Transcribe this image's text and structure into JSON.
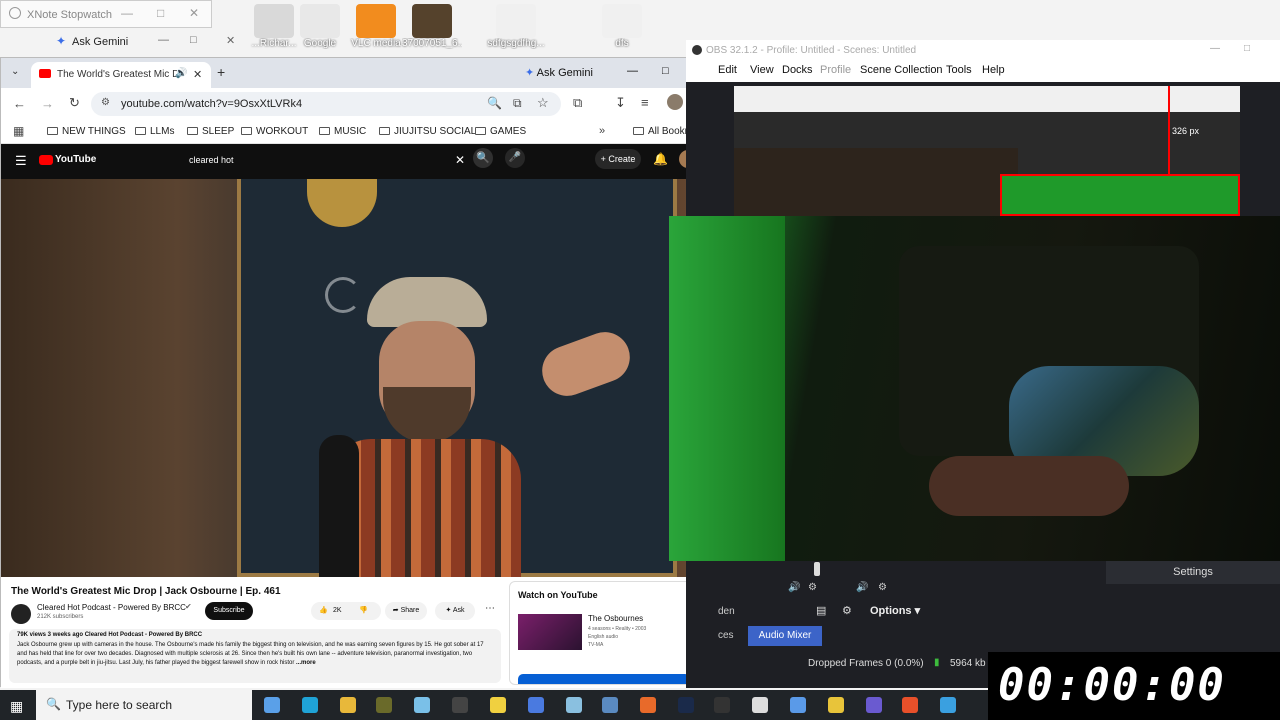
{
  "xnote": {
    "title": "XNote Stopwatch"
  },
  "gemini_float": {
    "label": "Ask Gemini"
  },
  "desktop_icons": [
    {
      "label": "...Richar...",
      "color": "#d9d9d9"
    },
    {
      "label": "Google",
      "color": "#e8e8e8"
    },
    {
      "label": "VLC media",
      "color": "#f28c1e"
    },
    {
      "label": "37007051_6...",
      "color": "#55422c"
    },
    {
      "label": "sdfgsgdfhg...",
      "color": "#f0f0f0"
    },
    {
      "label": "dfs",
      "color": "#f0f0f0"
    }
  ],
  "chrome": {
    "tab_title": "The World's Greatest Mic D...",
    "ask_gemini": "Ask Gemini",
    "url": "youtube.com/watch?v=9OsxXtLVRk4",
    "bookmarks": [
      "NEW THINGS",
      "LLMs",
      "SLEEP",
      "WORKOUT",
      "MUSIC",
      "JIUJITSU SOCIAL",
      "GAMES"
    ],
    "all_bookmarks": "All Bookmarks"
  },
  "youtube": {
    "logo": "YouTube",
    "search_value": "cleared hot",
    "create": "Create",
    "video_title": "The World's Greatest Mic Drop | Jack Osbourne | Ep. 461",
    "channel": "Cleared Hot Podcast - Powered By BRCC",
    "subscribers": "212K subscribers",
    "subscribe": "Subscribe",
    "likes": "2K",
    "share": "Share",
    "ask": "Ask",
    "meta": "79K views  3 weeks ago  Cleared Hot Podcast - Powered By BRCC",
    "description": "Jack Osbourne grew up with cameras in the house. The Osbourne's made his family the biggest thing on television, and he was earning seven figures by 15. He got sober at 17 and has held that line for over two decades. Diagnosed with multiple sclerosis at 26. Since then he's built his own lane -- adventure television, paranormal investigation, two podcasts, and a purple belt in jiu-jitsu. Last July, his father played the biggest farewell show in rock histor",
    "more": "...more",
    "watch_on": "Watch on YouTube",
    "suggest_title": "The Osbournes",
    "suggest_meta1": "4 seasons • Reality • 2003",
    "suggest_meta2": "English audio",
    "suggest_rating": "TV-MA"
  },
  "obs": {
    "title": "OBS 32.1.2 - Profile: Untitled - Scenes: Untitled",
    "menu": [
      "Edit",
      "View",
      "Docks",
      "Profile",
      "Scene Collection",
      "Tools",
      "Help"
    ],
    "overlay_text": "326 px",
    "settings": "Settings",
    "docks_label": "den",
    "options": "Options",
    "sources_tab": "ces",
    "audio_mixer": "Audio Mixer",
    "dropped": "Dropped Frames 0 (0.0%)",
    "bitrate": "5964 kb"
  },
  "taskbar": {
    "search_placeholder": "Type here to search"
  },
  "stopwatch": {
    "time": "00:00:00"
  }
}
